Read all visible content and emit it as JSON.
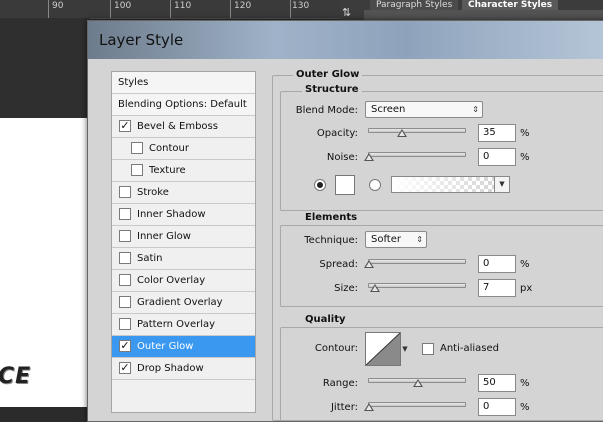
{
  "ruler": {
    "marks": [
      "90",
      "100",
      "110",
      "120",
      "130"
    ]
  },
  "canvas": {
    "logo_text": "CE"
  },
  "top_panel": {
    "tab_paragraph": "Paragraph Styles",
    "tab_character": "Character Styles"
  },
  "dialog": {
    "title": "Layer Style"
  },
  "styles_list": {
    "header": "Styles",
    "blending": "Blending Options: Default",
    "items": [
      {
        "label": "Bevel & Emboss",
        "checked": true
      },
      {
        "label": "Contour",
        "checked": false
      },
      {
        "label": "Texture",
        "checked": false
      },
      {
        "label": "Stroke",
        "checked": false
      },
      {
        "label": "Inner Shadow",
        "checked": false
      },
      {
        "label": "Inner Glow",
        "checked": false
      },
      {
        "label": "Satin",
        "checked": false
      },
      {
        "label": "Color Overlay",
        "checked": false
      },
      {
        "label": "Gradient Overlay",
        "checked": false
      },
      {
        "label": "Pattern Overlay",
        "checked": false
      },
      {
        "label": "Outer Glow",
        "checked": true,
        "selected": true
      },
      {
        "label": "Drop Shadow",
        "checked": true
      }
    ]
  },
  "outer_glow": {
    "section_title": "Outer Glow",
    "structure": {
      "title": "Structure",
      "blend_mode_label": "Blend Mode:",
      "blend_mode_value": "Screen",
      "opacity_label": "Opacity:",
      "opacity_value": "35",
      "opacity_unit": "%",
      "noise_label": "Noise:",
      "noise_value": "0",
      "noise_unit": "%",
      "color_mode": "solid"
    },
    "elements": {
      "title": "Elements",
      "technique_label": "Technique:",
      "technique_value": "Softer",
      "spread_label": "Spread:",
      "spread_value": "0",
      "spread_unit": "%",
      "size_label": "Size:",
      "size_value": "7",
      "size_unit": "px"
    },
    "quality": {
      "title": "Quality",
      "contour_label": "Contour:",
      "antialiased_label": "Anti-aliased",
      "antialiased_checked": false,
      "range_label": "Range:",
      "range_value": "50",
      "range_unit": "%",
      "jitter_label": "Jitter:",
      "jitter_value": "0",
      "jitter_unit": "%"
    }
  },
  "colors": {
    "selection": "#3b98f0",
    "dialog_bg": "#d4d4d4",
    "glow_color": "#ffffff"
  }
}
